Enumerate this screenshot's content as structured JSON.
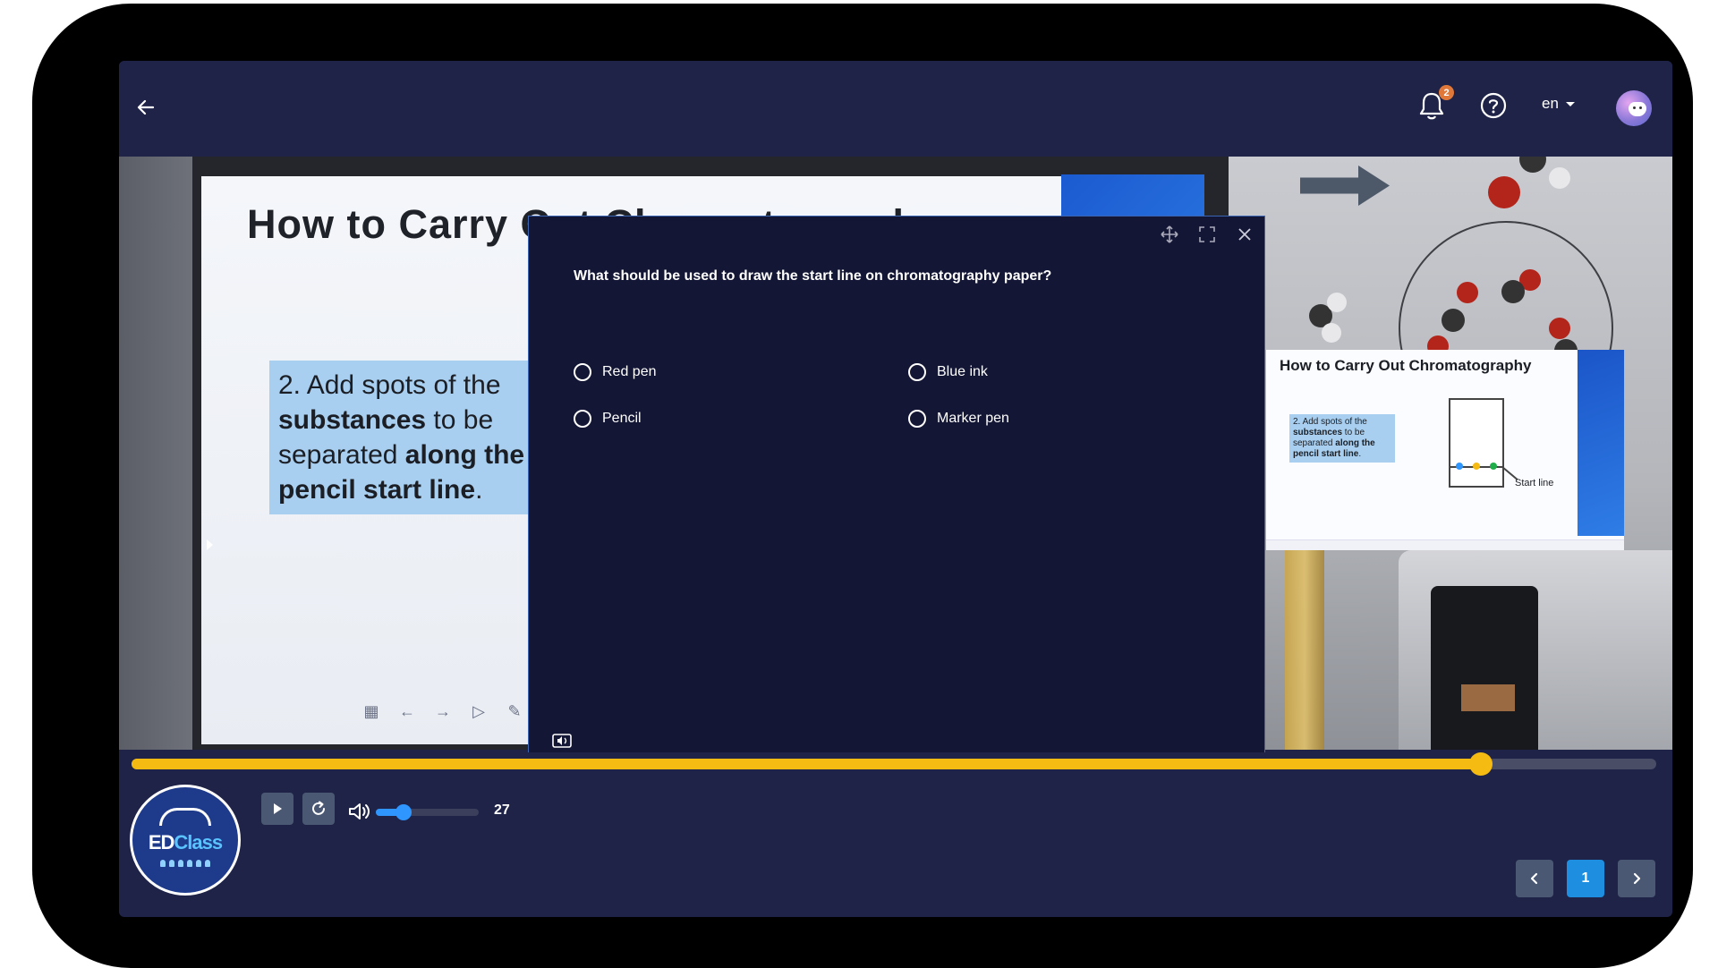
{
  "header": {
    "notification_count": "2",
    "language": "en"
  },
  "lesson_board": {
    "title": "How to Carry Out Chromatography",
    "note_parts": [
      "2. Add spots of the ",
      "substances",
      " to be separated ",
      "along the pencil start line",
      "."
    ]
  },
  "pip": {
    "title": "How to Carry Out Chromatography",
    "note_parts": [
      "2. Add spots of the ",
      "substances",
      " to be separated ",
      "along the pencil start line",
      "."
    ],
    "label": "Start line"
  },
  "quiz": {
    "question": "What should be used to draw the start line on chromatography paper?",
    "options": [
      {
        "label": "Red pen"
      },
      {
        "label": "Blue ink"
      },
      {
        "label": "Pencil"
      },
      {
        "label": "Marker pen"
      }
    ]
  },
  "player": {
    "progress": 0.885,
    "volume_value": "27",
    "volume_level": 0.27
  },
  "pagination": {
    "current_page": "1"
  },
  "logo": {
    "text_a": "ED",
    "text_b": "Class"
  },
  "colors": {
    "progress": "#f5bb12",
    "volume": "#2f95ff",
    "active_page": "#1e8fe0",
    "badge": "#e0783a"
  }
}
